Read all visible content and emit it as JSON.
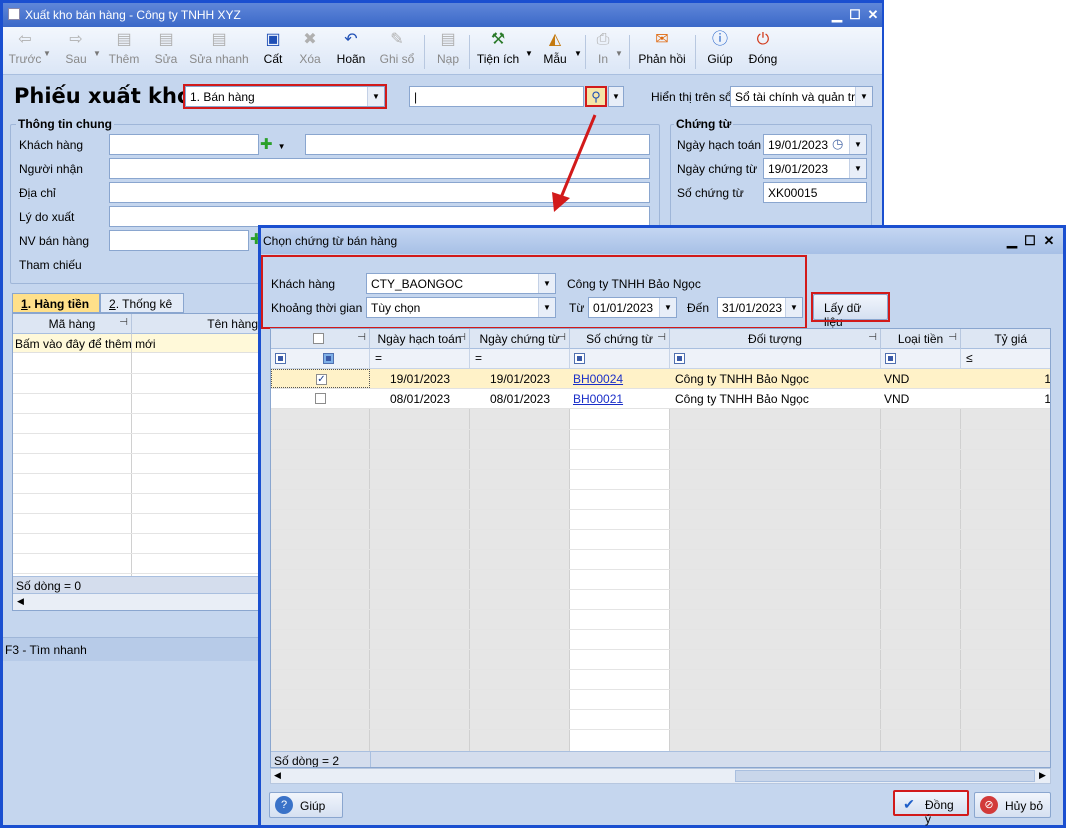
{
  "window": {
    "title": "Xuất kho bán hàng - Công ty TNHH XYZ"
  },
  "toolbar": [
    {
      "label": "Trước",
      "icon": "arrow-left-icon",
      "enabled": false
    },
    {
      "label": "Sau",
      "icon": "arrow-right-icon",
      "enabled": false
    },
    {
      "label": "Thêm",
      "icon": "add-doc-icon",
      "enabled": false
    },
    {
      "label": "Sửa",
      "icon": "edit-doc-icon",
      "enabled": false
    },
    {
      "label": "Sửa nhanh",
      "icon": "quick-edit-icon",
      "enabled": false
    },
    {
      "label": "Cất",
      "icon": "save-icon",
      "enabled": true
    },
    {
      "label": "Xóa",
      "icon": "delete-icon",
      "enabled": false
    },
    {
      "label": "Hoãn",
      "icon": "undo-icon",
      "enabled": true
    },
    {
      "label": "Ghi sổ",
      "icon": "pencil-icon",
      "enabled": false
    },
    {
      "label": "Nạp",
      "icon": "reload-icon",
      "enabled": false
    },
    {
      "label": "Tiện ích",
      "icon": "tools-icon",
      "enabled": true
    },
    {
      "label": "Mẫu",
      "icon": "template-icon",
      "enabled": true
    },
    {
      "label": "In",
      "icon": "print-icon",
      "enabled": false
    },
    {
      "label": "Phản hồi",
      "icon": "mail-icon",
      "enabled": true
    },
    {
      "label": "Giúp",
      "icon": "help-icon",
      "enabled": true
    },
    {
      "label": "Đóng",
      "icon": "power-icon",
      "enabled": true
    }
  ],
  "form": {
    "title": "Phiếu xuất kho",
    "type_value": "1. Bán hàng",
    "search_value": "|",
    "display_label": "Hiển thị trên sổ",
    "display_value": "Sổ tài chính và quản trị",
    "general_group": "Thông tin chung",
    "customer_label": "Khách hàng",
    "receiver_label": "Người nhận",
    "address_label": "Địa chỉ",
    "reason_label": "Lý do xuất",
    "sales_label": "NV bán hàng",
    "ref_label": "Tham chiếu",
    "voucher_group": "Chứng từ",
    "posting_date_label": "Ngày hạch toán",
    "posting_date": "19/01/2023",
    "voucher_date_label": "Ngày chứng từ",
    "voucher_date": "19/01/2023",
    "voucher_no_label": "Số chứng từ",
    "voucher_no": "XK00015"
  },
  "tabs": [
    {
      "key": "1",
      "label": "Hàng tiền"
    },
    {
      "key": "2",
      "label": "Thống kê"
    }
  ],
  "left_grid": {
    "col1": "Mã hàng",
    "col2": "Tên hàng",
    "new_row": "Bấm vào đây để thêm mới",
    "row_count": "Số dòng = 0"
  },
  "f3_label": "F3 - Tìm nhanh",
  "dialog": {
    "title": "Chọn chứng từ bán hàng",
    "customer_label": "Khách hàng",
    "customer_code": "CTY_BAONGOC",
    "customer_name": "Công ty TNHH Bảo Ngọc",
    "period_label": "Khoảng thời gian",
    "period_value": "Tùy chọn",
    "from_label": "Từ",
    "from_date": "01/01/2023",
    "to_label": "Đến",
    "to_date": "31/01/2023",
    "fetch_label": "Lấy dữ liệu",
    "columns": [
      "Ngày hạch toán",
      "Ngày chứng từ",
      "Số chứng từ",
      "Đối tượng",
      "Loại tiền",
      "Tỷ giá"
    ],
    "rows": [
      {
        "checked": true,
        "posting_date": "19/01/2023",
        "voucher_date": "19/01/2023",
        "voucher_no": "BH00024",
        "object": "Công ty TNHH Bảo Ngọc",
        "currency": "VND",
        "rate": "1"
      },
      {
        "checked": false,
        "posting_date": "08/01/2023",
        "voucher_date": "08/01/2023",
        "voucher_no": "BH00021",
        "object": "Công ty TNHH Bảo Ngọc",
        "currency": "VND",
        "rate": "1"
      }
    ],
    "row_count": "Số dòng = 2",
    "help_label": "Giúp",
    "ok_label": "Đồng ý",
    "cancel_label": "Hủy bỏ"
  },
  "colors": {
    "highlight": "#d21a1a",
    "title_bar": "#3b68c8",
    "link": "#1a2fc8"
  }
}
